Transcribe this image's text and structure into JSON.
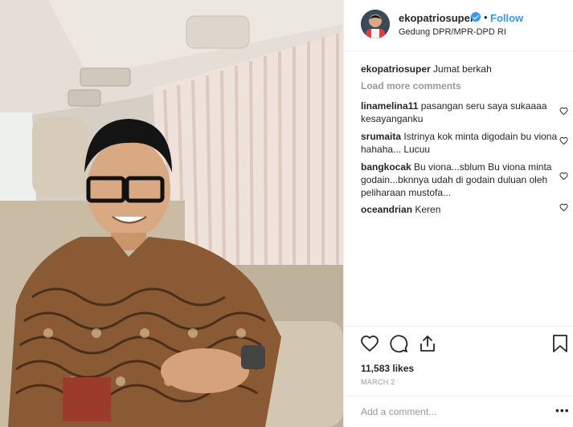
{
  "post": {
    "username": "ekopatriosuper",
    "follow_label": "Follow",
    "separator": "•",
    "location": "Gedung DPR/MPR-DPD RI",
    "caption_user": "ekopatriosuper",
    "caption_text": "Jumat berkah",
    "load_more": "Load more comments",
    "comments": [
      {
        "user": "linamelina11",
        "text": "pasangan seru saya sukaaaa kesayanganku"
      },
      {
        "user": "srumaita",
        "text": "Istrinya kok minta digodain bu viona hahaha... Lucuu"
      },
      {
        "user": "bangkocak",
        "text": "Bu viona...sblum Bu viona minta godain...bknnya udah di godain duluan oleh peliharaan mustofa..."
      },
      {
        "user": "oceandrian",
        "text": "Keren"
      }
    ],
    "likes": "11,583 likes",
    "date": "MARCH 2",
    "add_comment_placeholder": "Add a comment...",
    "more_options": "•••"
  },
  "icons": {
    "verified": "verified-badge-icon",
    "like": "heart-icon",
    "comment": "comment-icon",
    "share": "share-icon",
    "save": "bookmark-icon"
  },
  "colors": {
    "link": "#3897f0",
    "muted": "#999999",
    "text": "#262626"
  }
}
